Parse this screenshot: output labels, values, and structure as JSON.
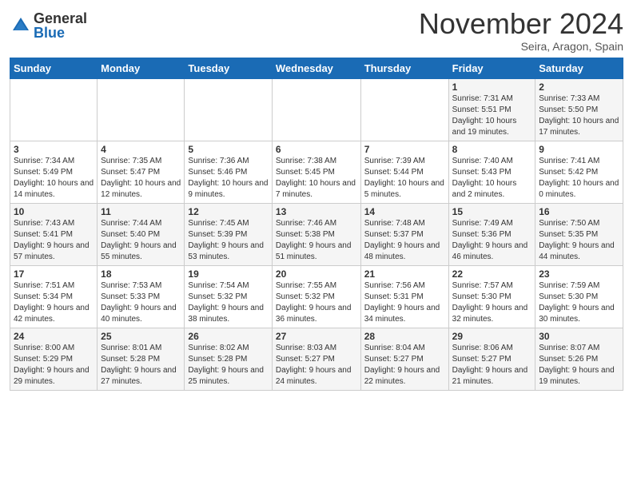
{
  "logo": {
    "general": "General",
    "blue": "Blue"
  },
  "header": {
    "month": "November 2024",
    "location": "Seira, Aragon, Spain"
  },
  "weekdays": [
    "Sunday",
    "Monday",
    "Tuesday",
    "Wednesday",
    "Thursday",
    "Friday",
    "Saturday"
  ],
  "weeks": [
    [
      {
        "day": "",
        "info": ""
      },
      {
        "day": "",
        "info": ""
      },
      {
        "day": "",
        "info": ""
      },
      {
        "day": "",
        "info": ""
      },
      {
        "day": "",
        "info": ""
      },
      {
        "day": "1",
        "info": "Sunrise: 7:31 AM\nSunset: 5:51 PM\nDaylight: 10 hours and 19 minutes."
      },
      {
        "day": "2",
        "info": "Sunrise: 7:33 AM\nSunset: 5:50 PM\nDaylight: 10 hours and 17 minutes."
      }
    ],
    [
      {
        "day": "3",
        "info": "Sunrise: 7:34 AM\nSunset: 5:49 PM\nDaylight: 10 hours and 14 minutes."
      },
      {
        "day": "4",
        "info": "Sunrise: 7:35 AM\nSunset: 5:47 PM\nDaylight: 10 hours and 12 minutes."
      },
      {
        "day": "5",
        "info": "Sunrise: 7:36 AM\nSunset: 5:46 PM\nDaylight: 10 hours and 9 minutes."
      },
      {
        "day": "6",
        "info": "Sunrise: 7:38 AM\nSunset: 5:45 PM\nDaylight: 10 hours and 7 minutes."
      },
      {
        "day": "7",
        "info": "Sunrise: 7:39 AM\nSunset: 5:44 PM\nDaylight: 10 hours and 5 minutes."
      },
      {
        "day": "8",
        "info": "Sunrise: 7:40 AM\nSunset: 5:43 PM\nDaylight: 10 hours and 2 minutes."
      },
      {
        "day": "9",
        "info": "Sunrise: 7:41 AM\nSunset: 5:42 PM\nDaylight: 10 hours and 0 minutes."
      }
    ],
    [
      {
        "day": "10",
        "info": "Sunrise: 7:43 AM\nSunset: 5:41 PM\nDaylight: 9 hours and 57 minutes."
      },
      {
        "day": "11",
        "info": "Sunrise: 7:44 AM\nSunset: 5:40 PM\nDaylight: 9 hours and 55 minutes."
      },
      {
        "day": "12",
        "info": "Sunrise: 7:45 AM\nSunset: 5:39 PM\nDaylight: 9 hours and 53 minutes."
      },
      {
        "day": "13",
        "info": "Sunrise: 7:46 AM\nSunset: 5:38 PM\nDaylight: 9 hours and 51 minutes."
      },
      {
        "day": "14",
        "info": "Sunrise: 7:48 AM\nSunset: 5:37 PM\nDaylight: 9 hours and 48 minutes."
      },
      {
        "day": "15",
        "info": "Sunrise: 7:49 AM\nSunset: 5:36 PM\nDaylight: 9 hours and 46 minutes."
      },
      {
        "day": "16",
        "info": "Sunrise: 7:50 AM\nSunset: 5:35 PM\nDaylight: 9 hours and 44 minutes."
      }
    ],
    [
      {
        "day": "17",
        "info": "Sunrise: 7:51 AM\nSunset: 5:34 PM\nDaylight: 9 hours and 42 minutes."
      },
      {
        "day": "18",
        "info": "Sunrise: 7:53 AM\nSunset: 5:33 PM\nDaylight: 9 hours and 40 minutes."
      },
      {
        "day": "19",
        "info": "Sunrise: 7:54 AM\nSunset: 5:32 PM\nDaylight: 9 hours and 38 minutes."
      },
      {
        "day": "20",
        "info": "Sunrise: 7:55 AM\nSunset: 5:32 PM\nDaylight: 9 hours and 36 minutes."
      },
      {
        "day": "21",
        "info": "Sunrise: 7:56 AM\nSunset: 5:31 PM\nDaylight: 9 hours and 34 minutes."
      },
      {
        "day": "22",
        "info": "Sunrise: 7:57 AM\nSunset: 5:30 PM\nDaylight: 9 hours and 32 minutes."
      },
      {
        "day": "23",
        "info": "Sunrise: 7:59 AM\nSunset: 5:30 PM\nDaylight: 9 hours and 30 minutes."
      }
    ],
    [
      {
        "day": "24",
        "info": "Sunrise: 8:00 AM\nSunset: 5:29 PM\nDaylight: 9 hours and 29 minutes."
      },
      {
        "day": "25",
        "info": "Sunrise: 8:01 AM\nSunset: 5:28 PM\nDaylight: 9 hours and 27 minutes."
      },
      {
        "day": "26",
        "info": "Sunrise: 8:02 AM\nSunset: 5:28 PM\nDaylight: 9 hours and 25 minutes."
      },
      {
        "day": "27",
        "info": "Sunrise: 8:03 AM\nSunset: 5:27 PM\nDaylight: 9 hours and 24 minutes."
      },
      {
        "day": "28",
        "info": "Sunrise: 8:04 AM\nSunset: 5:27 PM\nDaylight: 9 hours and 22 minutes."
      },
      {
        "day": "29",
        "info": "Sunrise: 8:06 AM\nSunset: 5:27 PM\nDaylight: 9 hours and 21 minutes."
      },
      {
        "day": "30",
        "info": "Sunrise: 8:07 AM\nSunset: 5:26 PM\nDaylight: 9 hours and 19 minutes."
      }
    ]
  ]
}
